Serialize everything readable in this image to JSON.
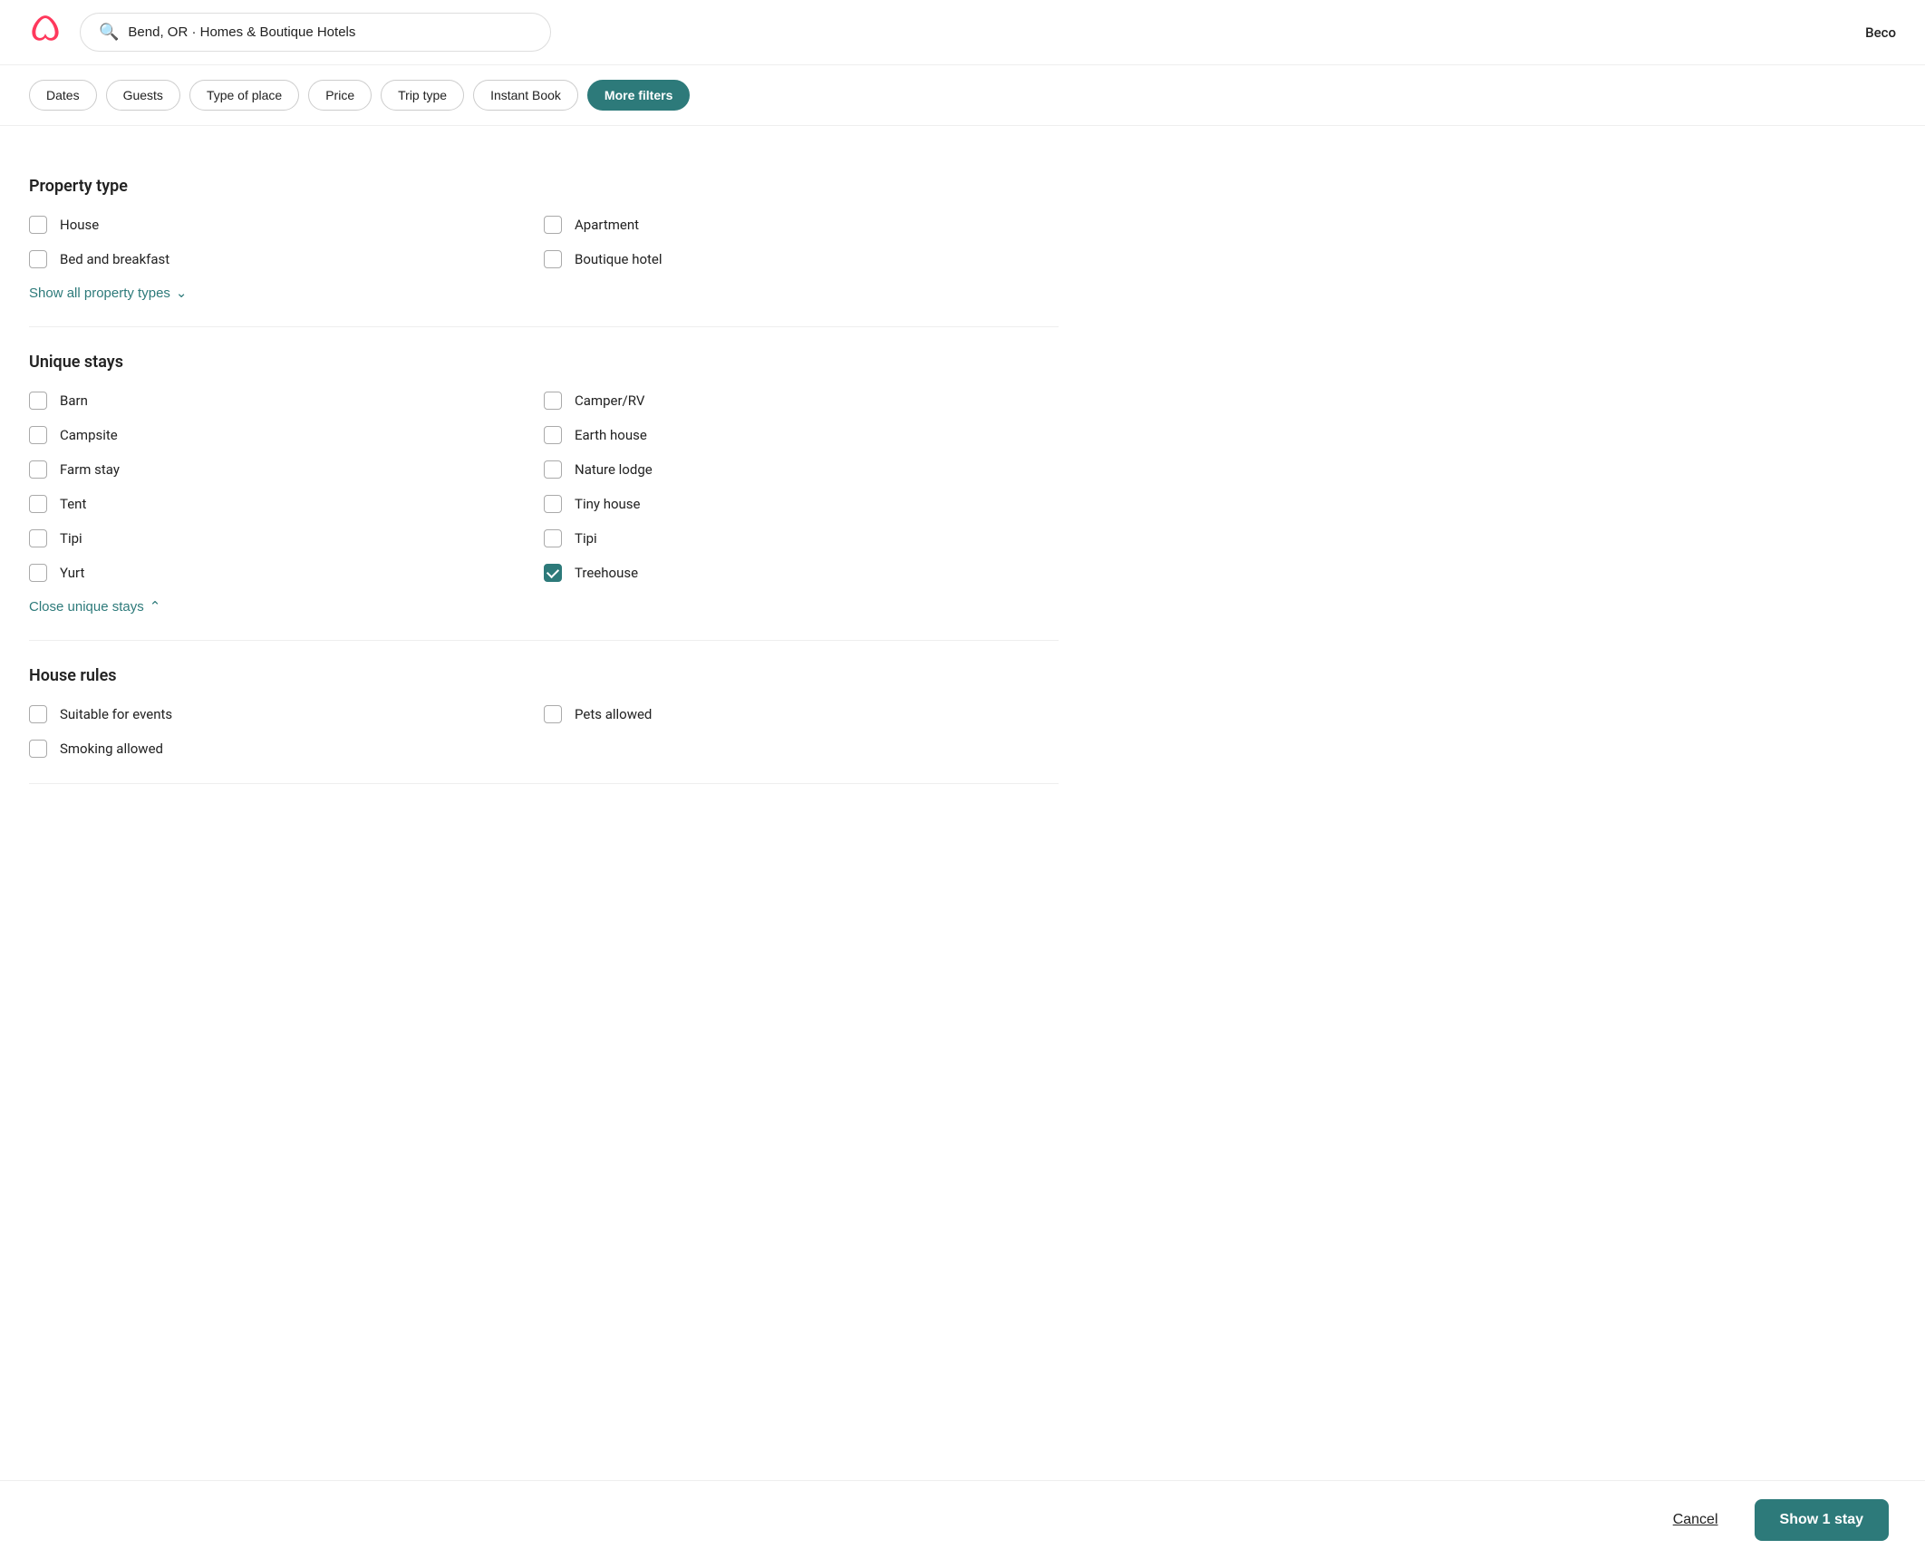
{
  "header": {
    "logo_label": "Airbnb",
    "search_value": "Bend, OR · Homes & Boutique Hotels",
    "search_placeholder": "Search",
    "user_label": "Beco"
  },
  "filter_bar": {
    "buttons": [
      {
        "id": "dates",
        "label": "Dates",
        "active": false
      },
      {
        "id": "guests",
        "label": "Guests",
        "active": false
      },
      {
        "id": "type_of_place",
        "label": "Type of place",
        "active": false
      },
      {
        "id": "price",
        "label": "Price",
        "active": false
      },
      {
        "id": "trip_type",
        "label": "Trip type",
        "active": false
      },
      {
        "id": "instant_book",
        "label": "Instant Book",
        "active": false
      },
      {
        "id": "more_filters",
        "label": "More filters",
        "active": true
      }
    ]
  },
  "property_type": {
    "section_title": "Property type",
    "col1": [
      {
        "id": "house",
        "label": "House",
        "checked": false
      },
      {
        "id": "bed_and_breakfast",
        "label": "Bed and breakfast",
        "checked": false
      }
    ],
    "col2": [
      {
        "id": "apartment",
        "label": "Apartment",
        "checked": false
      },
      {
        "id": "boutique_hotel",
        "label": "Boutique hotel",
        "checked": false
      }
    ],
    "show_all_label": "Show all property types",
    "show_all_icon": "chevron-down"
  },
  "unique_stays": {
    "section_title": "Unique stays",
    "col1": [
      {
        "id": "barn",
        "label": "Barn",
        "checked": false
      },
      {
        "id": "campsite",
        "label": "Campsite",
        "checked": false
      },
      {
        "id": "farm_stay",
        "label": "Farm stay",
        "checked": false
      },
      {
        "id": "tent",
        "label": "Tent",
        "checked": false
      },
      {
        "id": "tipi",
        "label": "Tipi",
        "checked": false
      },
      {
        "id": "yurt",
        "label": "Yurt",
        "checked": false
      }
    ],
    "col2": [
      {
        "id": "camper_rv",
        "label": "Camper/RV",
        "checked": false
      },
      {
        "id": "earth_house",
        "label": "Earth house",
        "checked": false
      },
      {
        "id": "nature_lodge",
        "label": "Nature lodge",
        "checked": false
      },
      {
        "id": "tiny_house",
        "label": "Tiny house",
        "checked": false
      },
      {
        "id": "tipi2",
        "label": "Tipi",
        "checked": false
      },
      {
        "id": "treehouse",
        "label": "Treehouse",
        "checked": true
      }
    ],
    "close_label": "Close unique stays",
    "close_icon": "chevron-up"
  },
  "house_rules": {
    "section_title": "House rules",
    "col1": [
      {
        "id": "suitable_for_events",
        "label": "Suitable for events",
        "checked": false
      },
      {
        "id": "smoking_allowed",
        "label": "Smoking allowed",
        "checked": false
      }
    ],
    "col2": [
      {
        "id": "pets_allowed",
        "label": "Pets allowed",
        "checked": false
      }
    ]
  },
  "footer": {
    "cancel_label": "Cancel",
    "show_label": "Show 1 stay"
  }
}
